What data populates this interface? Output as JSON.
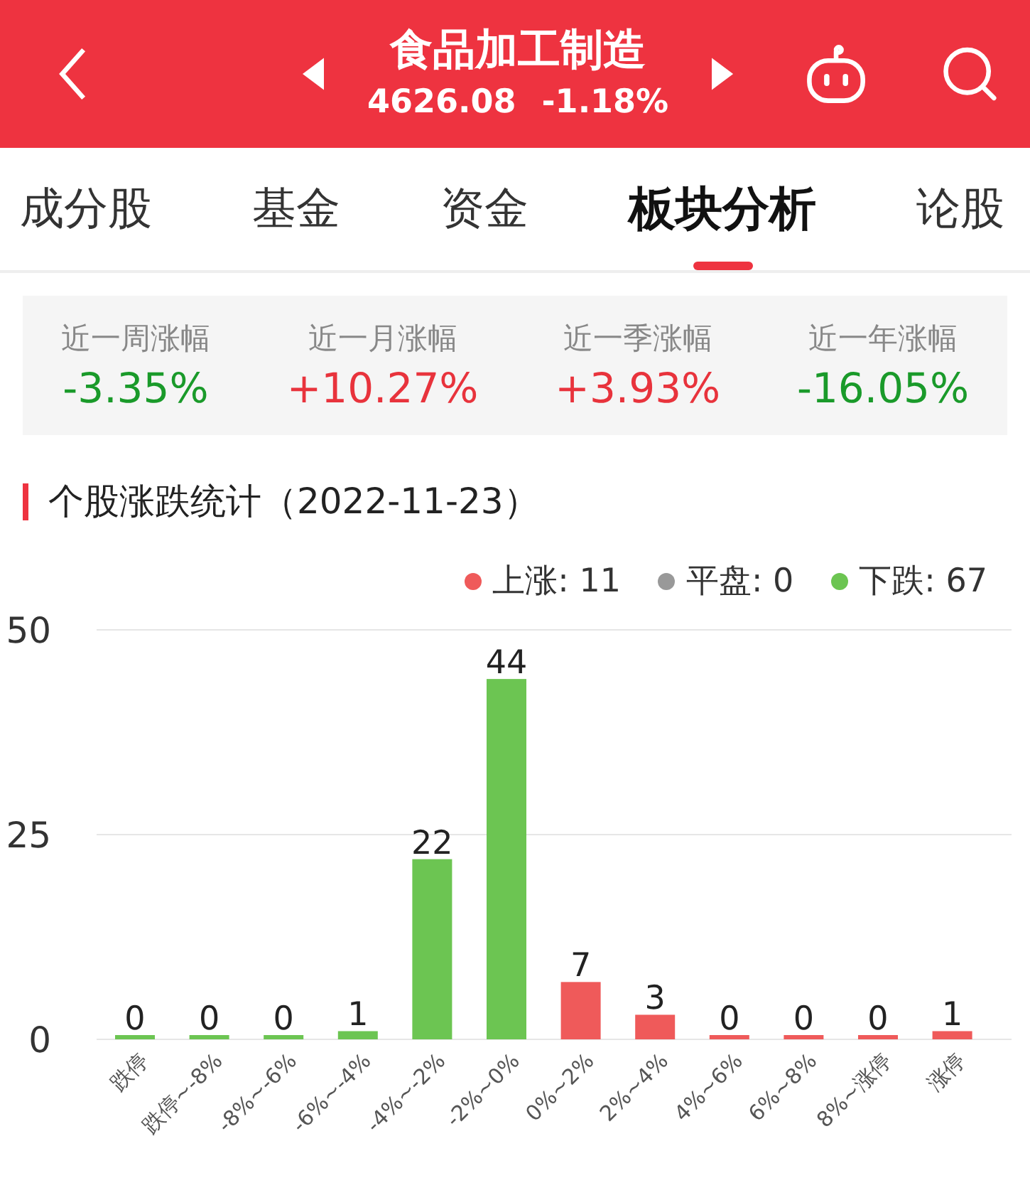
{
  "header": {
    "title": "食品加工制造",
    "price": "4626.08",
    "change": "-1.18%"
  },
  "tabs": [
    {
      "label": "成分股",
      "selected": false
    },
    {
      "label": "基金",
      "selected": false
    },
    {
      "label": "资金",
      "selected": false
    },
    {
      "label": "板块分析",
      "selected": true
    },
    {
      "label": "论股",
      "selected": false
    }
  ],
  "periods": [
    {
      "label": "近一周涨幅",
      "value": "-3.35%",
      "color": "#1a9a2a"
    },
    {
      "label": "近一月涨幅",
      "value": "+10.27%",
      "color": "#e8333c"
    },
    {
      "label": "近一季涨幅",
      "value": "+3.93%",
      "color": "#e8333c"
    },
    {
      "label": "近一年涨幅",
      "value": "-16.05%",
      "color": "#1a9a2a"
    }
  ],
  "section_title": "个股涨跌统计（2022-11-23）",
  "legend": [
    {
      "label": "上涨: 11",
      "color": "#ef5a5a"
    },
    {
      "label": "平盘: 0",
      "color": "#999999"
    },
    {
      "label": "下跌: 67",
      "color": "#6cc552"
    }
  ],
  "chart_data": {
    "type": "bar",
    "stacked": true,
    "data_labels": true,
    "categories": [
      "跌停",
      "跌停~-8%",
      "-8%~-6%",
      "-6%~-4%",
      "-4%~-2%",
      "-2%~0%",
      "0%~2%",
      "2%~4%",
      "4%~6%",
      "6%~8%",
      "8%~涨停",
      "涨停"
    ],
    "series": [
      {
        "color": "#6cc552",
        "values": [
          0,
          0,
          0,
          1,
          22,
          44,
          null,
          null,
          null,
          null,
          null,
          null
        ]
      },
      {
        "color": "#ef5a5a",
        "values": [
          null,
          null,
          null,
          null,
          null,
          null,
          7,
          3,
          0,
          0,
          0,
          1
        ]
      }
    ],
    "ylim": [
      0,
      50
    ],
    "yticks": [
      0,
      25,
      50
    ]
  }
}
